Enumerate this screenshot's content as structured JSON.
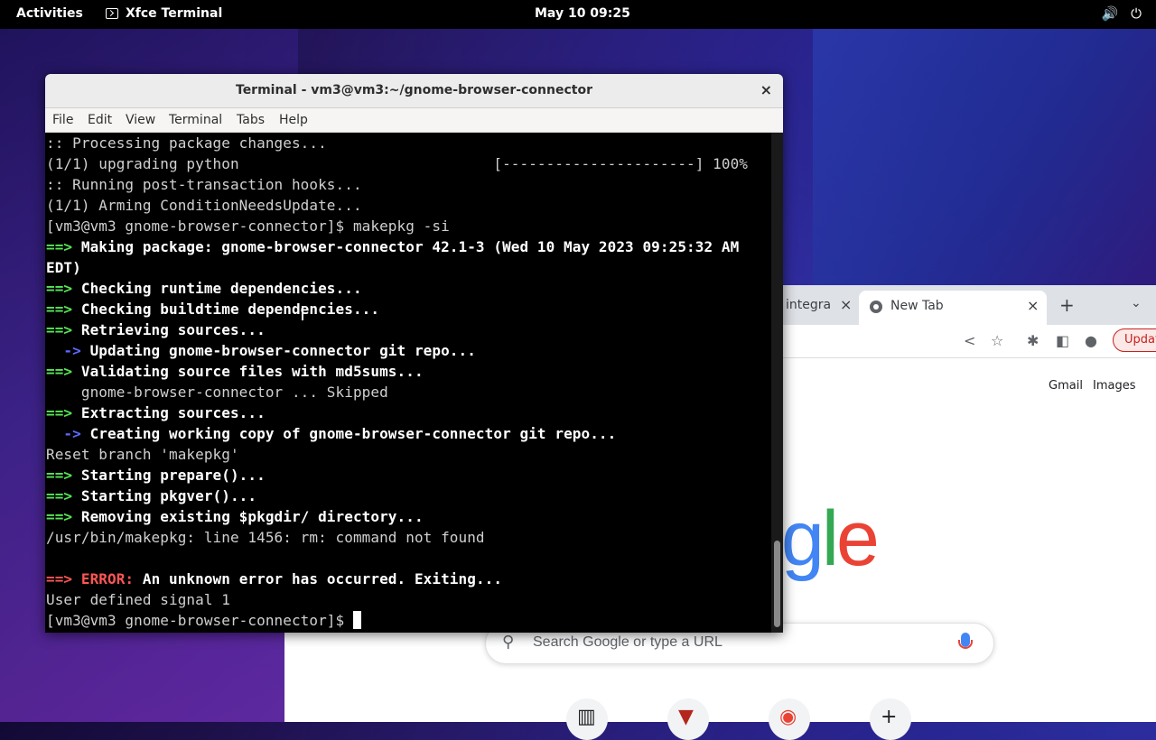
{
  "topbar": {
    "activities": "Activities",
    "app_name": "Xfce Terminal",
    "clock": "May 10  09:25",
    "volume_icon": "🔊",
    "power_icon": "⏻"
  },
  "terminal": {
    "title": "Terminal - vm3@vm3:~/gnome-browser-connector",
    "close": "×",
    "menu": [
      "File",
      "Edit",
      "View",
      "Terminal",
      "Tabs",
      "Help"
    ],
    "lines": {
      "l1": ":: Processing package changes...",
      "l2": "(1/1) upgrading python                             [----------------------] 100%",
      "l3": ":: Running post-transaction hooks...",
      "l4": "(1/1) Arming ConditionNeedsUpdate...",
      "l5": "[vm3@vm3 gnome-browser-connector]$ makepkg -si",
      "l6_arrow": "==>",
      "l6_text": " Making package: gnome-browser-connector 42.1-3 (Wed 10 May 2023 09:25:32 AM",
      "l7_text": "EDT)",
      "l8_arrow": "==>",
      "l8_text": " Checking runtime dependencies...",
      "l9_arrow": "==>",
      "l9_text": " Checking buildtime dependencies...",
      "l10_arrow": "==>",
      "l10_text": " Retrieving sources...",
      "l11_arrow": "  ->",
      "l11_text": " Updating gnome-browser-connector git repo...",
      "l12_arrow": "==>",
      "l12_text": " Validating source files with md5sums...",
      "l13": "    gnome-browser-connector ... Skipped",
      "l14_arrow": "==>",
      "l14_text": " Extracting sources...",
      "l15_arrow": "  ->",
      "l15_text": " Creating working copy of gnome-browser-connector git repo...",
      "l16": "Reset branch 'makepkg'",
      "l17_arrow": "==>",
      "l17_text": " Starting prepare()...",
      "l18_arrow": "==>",
      "l18_text": " Starting pkgver()...",
      "l19_arrow": "==>",
      "l19_text": " Removing existing $pkgdir/ directory...",
      "l20": "/usr/bin/makepkg: line 1456: rm: command not found",
      "l22_arrow": "==>",
      "l22_err": " ERROR:",
      "l22_text": " An unknown error has occurred. Exiting...",
      "l23": "User defined signal 1",
      "l24": "[vm3@vm3 gnome-browser-connector]$ "
    }
  },
  "browser": {
    "tab1_title": "integra",
    "tab1_close": "×",
    "tab2_title": "New Tab",
    "tab2_close": "×",
    "new_tab": "+",
    "tab_menu": "⌄",
    "update_label": "Update",
    "gmail": "Gmail",
    "images": "Images",
    "logo_g": "g",
    "logo_l": "l",
    "logo_e": "e",
    "search_placeholder": "Search Google or type a URL",
    "add_shortcut": "+"
  }
}
